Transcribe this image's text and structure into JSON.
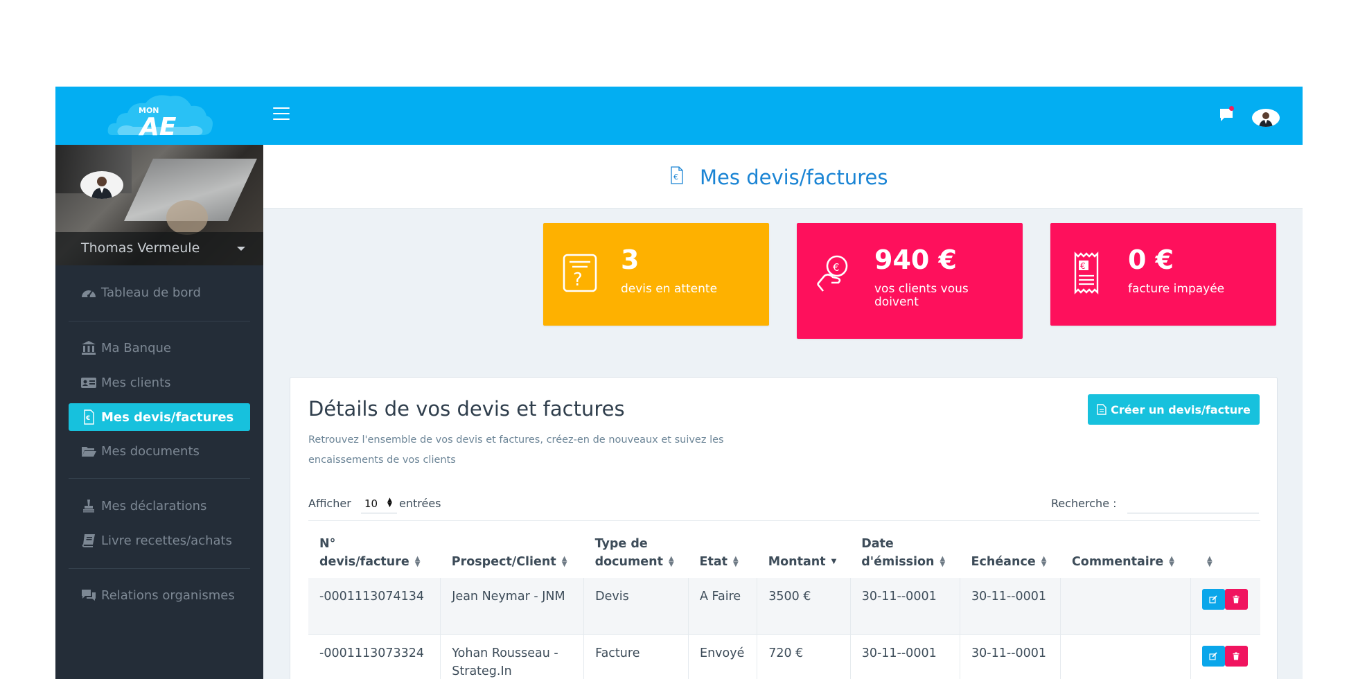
{
  "app": {
    "logo_text": "MON AE",
    "colors": {
      "topbar": "#03aef2",
      "sidebar": "#242d38",
      "accent": "#17c1dd",
      "orange": "#feb100",
      "pink": "#fe105c"
    }
  },
  "header": {
    "menu_icon": "hamburger-icon",
    "chat_icon": "chat-icon",
    "notification_dot": true
  },
  "sidebar": {
    "user_name": "Thomas Vermeule",
    "items": [
      {
        "label": "Tableau de bord",
        "icon": "dashboard-icon"
      },
      {
        "label": "Ma Banque",
        "icon": "bank-icon"
      },
      {
        "label": "Mes clients",
        "icon": "id-card-icon"
      },
      {
        "label": "Mes devis/factures",
        "icon": "invoice-icon",
        "active": true
      },
      {
        "label": "Mes documents",
        "icon": "folder-open-icon"
      },
      {
        "label": "Mes déclarations",
        "icon": "stamp-icon"
      },
      {
        "label": "Livre recettes/achats",
        "icon": "book-icon"
      },
      {
        "label": "Relations organismes",
        "icon": "comments-icon"
      }
    ]
  },
  "page": {
    "title": "Mes devis/factures",
    "title_icon": "euro-document-icon"
  },
  "stats": [
    {
      "value": "3",
      "label": "devis en attente",
      "icon": "question-document-icon",
      "color": "#feb100"
    },
    {
      "value": "940 €",
      "label": "vos clients vous doivent",
      "icon": "money-hand-icon",
      "color": "#fe105c"
    },
    {
      "value": "0 €",
      "label": "facture impayée",
      "icon": "receipt-icon",
      "color": "#fe105c"
    }
  ],
  "card": {
    "title": "Détails de vos devis et factures",
    "subtitle": "Retrouvez l'ensemble de vos devis et factures, créez-en de nouveaux et suivez les encaissements de vos clients",
    "create_button": "Créer un devis/facture",
    "show_label": "Afficher",
    "entries_value": "10",
    "entries_label": "entrées",
    "search_label": "Recherche :",
    "search_value": ""
  },
  "table": {
    "columns": [
      {
        "l1": "N°",
        "l2": "devis/facture"
      },
      {
        "l1": "",
        "l2": "Prospect/Client"
      },
      {
        "l1": "Type de",
        "l2": "document"
      },
      {
        "l1": "",
        "l2": "Etat"
      },
      {
        "l1": "",
        "l2": "Montant"
      },
      {
        "l1": "Date",
        "l2": "d'émission"
      },
      {
        "l1": "",
        "l2": "Echéance"
      },
      {
        "l1": "",
        "l2": "Commentaire"
      },
      {
        "l1": "",
        "l2": ""
      }
    ],
    "rows": [
      {
        "numero": "-0001113074134",
        "client": "Jean Neymar - JNM",
        "type": "Devis",
        "etat": "A Faire",
        "montant": "3500 €",
        "emission": "30-11--0001",
        "echeance": "30-11--0001",
        "commentaire": ""
      },
      {
        "numero": "-0001113073324",
        "client": "Yohan Rousseau - Strateg.In",
        "type": "Facture",
        "etat": "Envoyé",
        "montant": "720 €",
        "emission": "30-11--0001",
        "echeance": "30-11--0001",
        "commentaire": ""
      }
    ]
  }
}
